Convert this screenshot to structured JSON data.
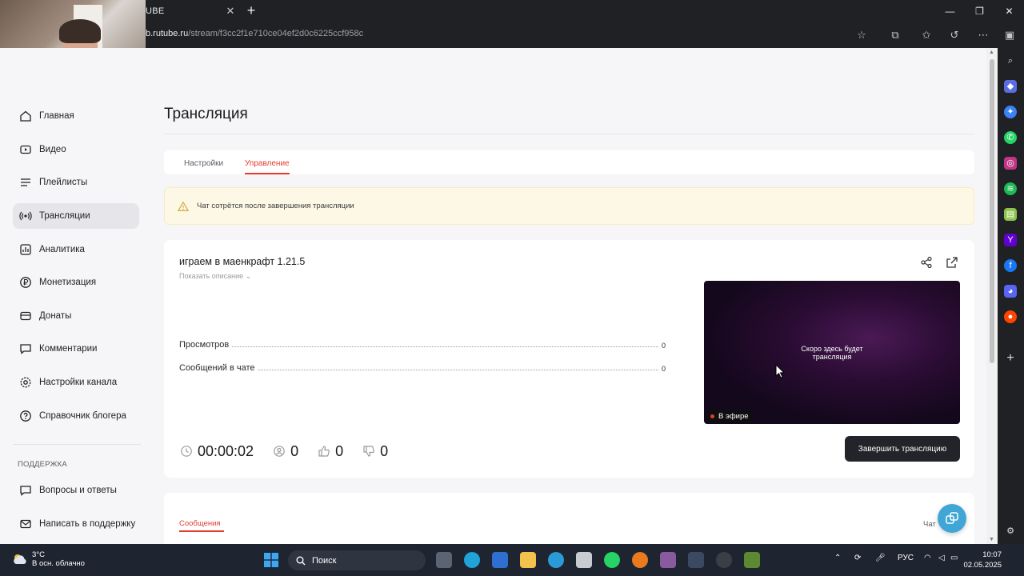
{
  "browser": {
    "tab_title": "UBE",
    "url_host": "b.rutube.ru",
    "url_path": "/stream/f3cc2f1e710ce04ef2d0c6225ccf958c"
  },
  "sidebar": {
    "items": [
      {
        "label": "Главная",
        "icon": "home-icon"
      },
      {
        "label": "Видео",
        "icon": "video-icon"
      },
      {
        "label": "Плейлисты",
        "icon": "playlist-icon"
      },
      {
        "label": "Трансляции",
        "icon": "broadcast-icon"
      },
      {
        "label": "Аналитика",
        "icon": "analytics-icon"
      },
      {
        "label": "Монетизация",
        "icon": "ruble-icon"
      },
      {
        "label": "Донаты",
        "icon": "donate-icon"
      },
      {
        "label": "Комментарии",
        "icon": "comment-icon"
      },
      {
        "label": "Настройки канала",
        "icon": "gear-icon"
      },
      {
        "label": "Справочник блогера",
        "icon": "help-icon"
      }
    ],
    "support_section": "ПОДДЕРЖКА",
    "support_items": [
      {
        "label": "Вопросы и ответы",
        "icon": "faq-icon"
      },
      {
        "label": "Написать в поддержку",
        "icon": "mail-icon"
      }
    ],
    "active_index": 3
  },
  "main": {
    "title": "Трансляция",
    "tabs": [
      {
        "label": "Настройки",
        "active": false
      },
      {
        "label": "Управление",
        "active": true
      }
    ],
    "alert": "Чат сотрётся после завершения трансляции",
    "stream": {
      "title": "играем в маенкрафт 1.21.5",
      "show_description": "Показать описание",
      "stats": [
        {
          "label": "Просмотров",
          "value": "0"
        },
        {
          "label": "Сообщений в чате",
          "value": "0"
        }
      ],
      "preview_text": "Скоро здесь будет трансляция",
      "live_badge": "В эфире",
      "timer": "00:00:02",
      "viewers": "0",
      "likes": "0",
      "dislikes": "0",
      "end_button": "Завершить трансляцию"
    },
    "messages_tab": "Сообщения",
    "chat_label": "Чат"
  },
  "taskbar": {
    "weather_temp": "3°C",
    "weather_desc": "В осн. облачно",
    "search_placeholder": "Поиск",
    "lang": "РУС",
    "time": "10:07",
    "date": "02.05.2025"
  },
  "colors": {
    "accent": "#e33b2e",
    "alert_bg": "#fdf8e6",
    "button_dark": "#23232a"
  }
}
